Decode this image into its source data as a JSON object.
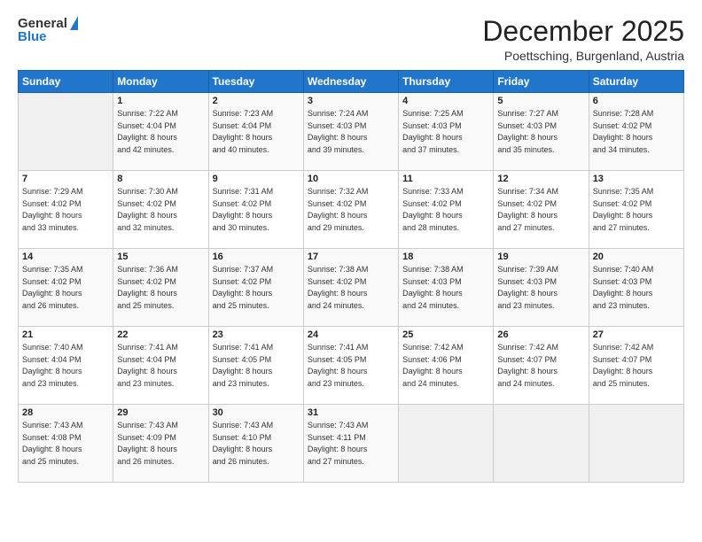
{
  "logo": {
    "general": "General",
    "blue": "Blue"
  },
  "title": "December 2025",
  "subtitle": "Poettsching, Burgenland, Austria",
  "days_header": [
    "Sunday",
    "Monday",
    "Tuesday",
    "Wednesday",
    "Thursday",
    "Friday",
    "Saturday"
  ],
  "weeks": [
    [
      {
        "day": "",
        "info": ""
      },
      {
        "day": "1",
        "info": "Sunrise: 7:22 AM\nSunset: 4:04 PM\nDaylight: 8 hours\nand 42 minutes."
      },
      {
        "day": "2",
        "info": "Sunrise: 7:23 AM\nSunset: 4:04 PM\nDaylight: 8 hours\nand 40 minutes."
      },
      {
        "day": "3",
        "info": "Sunrise: 7:24 AM\nSunset: 4:03 PM\nDaylight: 8 hours\nand 39 minutes."
      },
      {
        "day": "4",
        "info": "Sunrise: 7:25 AM\nSunset: 4:03 PM\nDaylight: 8 hours\nand 37 minutes."
      },
      {
        "day": "5",
        "info": "Sunrise: 7:27 AM\nSunset: 4:03 PM\nDaylight: 8 hours\nand 35 minutes."
      },
      {
        "day": "6",
        "info": "Sunrise: 7:28 AM\nSunset: 4:02 PM\nDaylight: 8 hours\nand 34 minutes."
      }
    ],
    [
      {
        "day": "7",
        "info": "Sunrise: 7:29 AM\nSunset: 4:02 PM\nDaylight: 8 hours\nand 33 minutes."
      },
      {
        "day": "8",
        "info": "Sunrise: 7:30 AM\nSunset: 4:02 PM\nDaylight: 8 hours\nand 32 minutes."
      },
      {
        "day": "9",
        "info": "Sunrise: 7:31 AM\nSunset: 4:02 PM\nDaylight: 8 hours\nand 30 minutes."
      },
      {
        "day": "10",
        "info": "Sunrise: 7:32 AM\nSunset: 4:02 PM\nDaylight: 8 hours\nand 29 minutes."
      },
      {
        "day": "11",
        "info": "Sunrise: 7:33 AM\nSunset: 4:02 PM\nDaylight: 8 hours\nand 28 minutes."
      },
      {
        "day": "12",
        "info": "Sunrise: 7:34 AM\nSunset: 4:02 PM\nDaylight: 8 hours\nand 27 minutes."
      },
      {
        "day": "13",
        "info": "Sunrise: 7:35 AM\nSunset: 4:02 PM\nDaylight: 8 hours\nand 27 minutes."
      }
    ],
    [
      {
        "day": "14",
        "info": "Sunrise: 7:35 AM\nSunset: 4:02 PM\nDaylight: 8 hours\nand 26 minutes."
      },
      {
        "day": "15",
        "info": "Sunrise: 7:36 AM\nSunset: 4:02 PM\nDaylight: 8 hours\nand 25 minutes."
      },
      {
        "day": "16",
        "info": "Sunrise: 7:37 AM\nSunset: 4:02 PM\nDaylight: 8 hours\nand 25 minutes."
      },
      {
        "day": "17",
        "info": "Sunrise: 7:38 AM\nSunset: 4:02 PM\nDaylight: 8 hours\nand 24 minutes."
      },
      {
        "day": "18",
        "info": "Sunrise: 7:38 AM\nSunset: 4:03 PM\nDaylight: 8 hours\nand 24 minutes."
      },
      {
        "day": "19",
        "info": "Sunrise: 7:39 AM\nSunset: 4:03 PM\nDaylight: 8 hours\nand 23 minutes."
      },
      {
        "day": "20",
        "info": "Sunrise: 7:40 AM\nSunset: 4:03 PM\nDaylight: 8 hours\nand 23 minutes."
      }
    ],
    [
      {
        "day": "21",
        "info": "Sunrise: 7:40 AM\nSunset: 4:04 PM\nDaylight: 8 hours\nand 23 minutes."
      },
      {
        "day": "22",
        "info": "Sunrise: 7:41 AM\nSunset: 4:04 PM\nDaylight: 8 hours\nand 23 minutes."
      },
      {
        "day": "23",
        "info": "Sunrise: 7:41 AM\nSunset: 4:05 PM\nDaylight: 8 hours\nand 23 minutes."
      },
      {
        "day": "24",
        "info": "Sunrise: 7:41 AM\nSunset: 4:05 PM\nDaylight: 8 hours\nand 23 minutes."
      },
      {
        "day": "25",
        "info": "Sunrise: 7:42 AM\nSunset: 4:06 PM\nDaylight: 8 hours\nand 24 minutes."
      },
      {
        "day": "26",
        "info": "Sunrise: 7:42 AM\nSunset: 4:07 PM\nDaylight: 8 hours\nand 24 minutes."
      },
      {
        "day": "27",
        "info": "Sunrise: 7:42 AM\nSunset: 4:07 PM\nDaylight: 8 hours\nand 25 minutes."
      }
    ],
    [
      {
        "day": "28",
        "info": "Sunrise: 7:43 AM\nSunset: 4:08 PM\nDaylight: 8 hours\nand 25 minutes."
      },
      {
        "day": "29",
        "info": "Sunrise: 7:43 AM\nSunset: 4:09 PM\nDaylight: 8 hours\nand 26 minutes."
      },
      {
        "day": "30",
        "info": "Sunrise: 7:43 AM\nSunset: 4:10 PM\nDaylight: 8 hours\nand 26 minutes."
      },
      {
        "day": "31",
        "info": "Sunrise: 7:43 AM\nSunset: 4:11 PM\nDaylight: 8 hours\nand 27 minutes."
      },
      {
        "day": "",
        "info": ""
      },
      {
        "day": "",
        "info": ""
      },
      {
        "day": "",
        "info": ""
      }
    ]
  ]
}
